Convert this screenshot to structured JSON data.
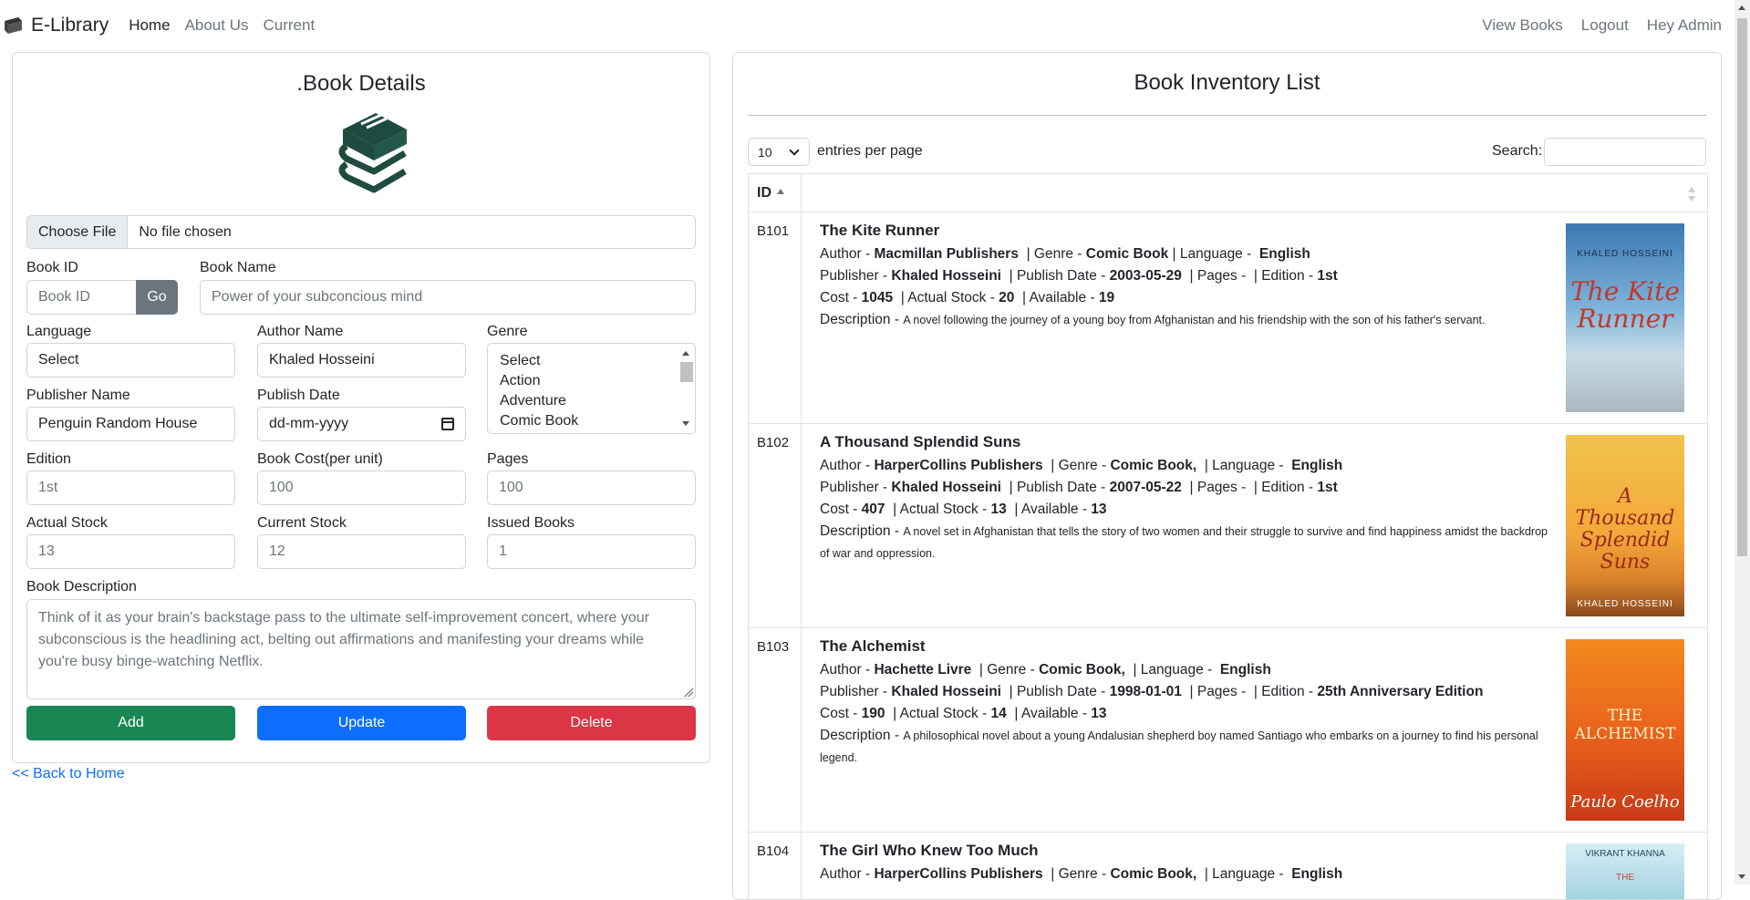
{
  "nav": {
    "brand": "E-Library",
    "left_links": [
      "Home",
      "About Us",
      "Current"
    ],
    "right_links": [
      "View Books",
      "Logout",
      "Hey Admin"
    ]
  },
  "form": {
    "title": ".Book Details",
    "file_button": "Choose File",
    "file_status": "No file chosen",
    "book_id_label": "Book ID",
    "book_id_placeholder": "Book ID",
    "go_label": "Go",
    "book_name_label": "Book Name",
    "book_name_placeholder": "Power of your subconcious mind",
    "language_label": "Language",
    "language_value": "Select",
    "author_label": "Author Name",
    "author_value": "Khaled Hosseini",
    "genre_label": "Genre",
    "genre_options": [
      "Select",
      "Action",
      "Adventure",
      "Comic Book"
    ],
    "publisher_label": "Publisher Name",
    "publisher_value": "Penguin Random House",
    "publish_date_label": "Publish Date",
    "publish_date_placeholder": "dd-mm-yyyy",
    "edition_label": "Edition",
    "edition_placeholder": "1st",
    "cost_label": "Book Cost(per unit)",
    "cost_placeholder": "100",
    "pages_label": "Pages",
    "pages_placeholder": "100",
    "actual_stock_label": "Actual Stock",
    "actual_stock_placeholder": "13",
    "current_stock_label": "Current Stock",
    "current_stock_placeholder": "12",
    "issued_label": "Issued Books",
    "issued_placeholder": "1",
    "description_label": "Book Description",
    "description_placeholder": " Think of it as your brain's backstage pass to the ultimate self-improvement concert, where your subconscious is the headlining act, belting out affirmations and manifesting your dreams while you're busy binge-watching Netflix.",
    "add_label": "Add",
    "update_label": "Update",
    "delete_label": "Delete",
    "back_link": "<< Back to Home"
  },
  "inventory": {
    "title": "Book Inventory List",
    "entries_value": "10",
    "entries_label": "entries per page",
    "search_label": "Search:",
    "id_header": "ID",
    "books": [
      {
        "id": "B101",
        "title": "The Kite Runner",
        "author": "Macmillan Publishers",
        "genre": "Comic Book",
        "language": "English",
        "publisher": "Khaled Hosseini",
        "publish_date": "2003-05-29",
        "pages": "",
        "edition": "1st",
        "cost": "1045",
        "actual_stock": "20",
        "available": "19",
        "description": "A novel following the journey of a young boy from Afghanistan and his friendship with the son of his father's servant.",
        "cover_author": "KHALED HOSSEINI",
        "cover_title": "The Kite Runner"
      },
      {
        "id": "B102",
        "title": "A Thousand Splendid Suns",
        "author": "HarperCollins Publishers",
        "genre": "Comic Book,",
        "language": "English",
        "publisher": "Khaled Hosseini",
        "publish_date": "2007-05-22",
        "pages": "",
        "edition": "1st",
        "cost": "407",
        "actual_stock": "13",
        "available": "13",
        "description": "A novel set in Afghanistan that tells the story of two women and their struggle to survive and find happiness amidst the backdrop of war and oppression.",
        "cover_author": "KHALED HOSSEINI",
        "cover_title": "A Thousand Splendid Suns"
      },
      {
        "id": "B103",
        "title": "The Alchemist",
        "author": "Hachette Livre",
        "genre": "Comic Book,",
        "language": "English",
        "publisher": "Khaled Hosseini",
        "publish_date": "1998-01-01",
        "pages": "",
        "edition": "25th Anniversary Edition",
        "cost": "190",
        "actual_stock": "14",
        "available": "13",
        "description": "A philosophical novel about a young Andalusian shepherd boy named Santiago who embarks on a journey to find his personal legend.",
        "cover_author": "Paulo Coelho",
        "cover_title": "THE ALCHEMIST"
      },
      {
        "id": "B104",
        "title": "The Girl Who Knew Too Much",
        "author": "HarperCollins Publishers",
        "genre": "Comic Book,",
        "language": "English",
        "cover_author": "VIKRANT KHANNA",
        "cover_title": "THE"
      }
    ]
  },
  "colors": {
    "add": "#198754",
    "update": "#0d6efd",
    "delete": "#dc3545",
    "logo": "#1f4a3f"
  }
}
